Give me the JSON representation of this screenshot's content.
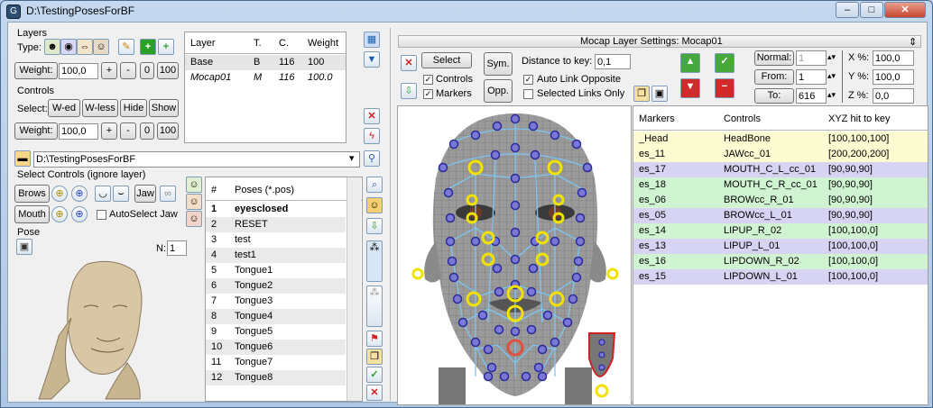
{
  "window": {
    "title": "D:\\TestingPosesForBF",
    "min": "–",
    "max": "□",
    "close": "✕"
  },
  "layers": {
    "title": "Layers",
    "type_label": "Type:",
    "weight_label": "Weight:",
    "weight_value": "100,0",
    "plus": "+",
    "minus": "-",
    "zero": "0",
    "hundred": "100",
    "table": {
      "headers": [
        "Layer",
        "T.",
        "C.",
        "Weight"
      ],
      "rows": [
        [
          "Base",
          "B",
          "116",
          "100"
        ],
        [
          "Mocap01",
          "M",
          "116",
          "100.0"
        ]
      ]
    }
  },
  "controls": {
    "title": "Controls",
    "select_label": "Select:",
    "buttons": [
      "W-ed",
      "W-less",
      "Hide",
      "Show"
    ],
    "weight_label": "Weight:",
    "weight_value": "100,0",
    "plus": "+",
    "minus": "-",
    "zero": "0",
    "hundred": "100"
  },
  "path": {
    "value": "D:\\TestingPosesForBF",
    "dropdown": "▾"
  },
  "select_controls": {
    "title": "Select Controls (ignore layer)",
    "brows": "Brows",
    "jaw": "Jaw",
    "mouth": "Mouth",
    "autoselect": "AutoSelect Jaw"
  },
  "pose": {
    "title": "Pose",
    "n_label": "N:",
    "n_value": "1"
  },
  "poses": {
    "headers": [
      "#",
      "Poses (*.pos)"
    ],
    "rows": [
      [
        "1",
        "eyesclosed"
      ],
      [
        "2",
        "RESET"
      ],
      [
        "3",
        "test"
      ],
      [
        "4",
        "test1"
      ],
      [
        "5",
        "Tongue1"
      ],
      [
        "6",
        "Tongue2"
      ],
      [
        "7",
        "Tongue3"
      ],
      [
        "8",
        "Tongue4"
      ],
      [
        "9",
        "Tongue5"
      ],
      [
        "10",
        "Tongue6"
      ],
      [
        "11",
        "Tongue7"
      ],
      [
        "12",
        "Tongue8"
      ]
    ]
  },
  "mocap": {
    "title": "Mocap Layer Settings: Mocap01",
    "collapse": "⇕",
    "select": "Select",
    "sym": "Sym.",
    "opp": "Opp.",
    "distance_label": "Distance to key:",
    "distance_value": "0,1",
    "controls_chk": "Controls",
    "markers_chk": "Markers",
    "auto_link": "Auto Link Opposite",
    "selected_links": "Selected Links Only",
    "normal_label": "Normal:",
    "normal_value": "1",
    "from_label": "From:",
    "from_value": "1",
    "to_label": "To:",
    "to_value": "616",
    "x_label": "X %:",
    "x_value": "100,0",
    "y_label": "Y %:",
    "y_value": "100,0",
    "z_label": "Z %:",
    "z_value": "0,0",
    "table": {
      "headers": [
        "Markers",
        "Controls",
        "XYZ hit to key"
      ],
      "rows": [
        {
          "m": "_Head",
          "c": "HeadBone",
          "x": "[100,100,100]",
          "color": "#fdfbd2"
        },
        {
          "m": "es_11",
          "c": "JAWcc_01",
          "x": "[200,200,200]",
          "color": "#fdfbd2"
        },
        {
          "m": "es_17",
          "c": "MOUTH_C_L_cc_01",
          "x": "[90,90,90]",
          "color": "#d6d4f2"
        },
        {
          "m": "es_18",
          "c": "MOUTH_C_R_cc_01",
          "x": "[90,90,90]",
          "color": "#d0f4d2"
        },
        {
          "m": "es_06",
          "c": "BROWcc_R_01",
          "x": "[90,90,90]",
          "color": "#d0f4d2"
        },
        {
          "m": "es_05",
          "c": "BROWcc_L_01",
          "x": "[90,90,90]",
          "color": "#d6d4f2"
        },
        {
          "m": "es_14",
          "c": "LIPUP_R_02",
          "x": "[100,100,0]",
          "color": "#d0f4d2"
        },
        {
          "m": "es_13",
          "c": "LIPUP_L_01",
          "x": "[100,100,0]",
          "color": "#d6d4f2"
        },
        {
          "m": "es_16",
          "c": "LIPDOWN_R_02",
          "x": "[100,100,0]",
          "color": "#d0f4d2"
        },
        {
          "m": "es_15",
          "c": "LIPDOWN_L_01",
          "x": "[100,100,0]",
          "color": "#d6d4f2"
        }
      ]
    }
  }
}
